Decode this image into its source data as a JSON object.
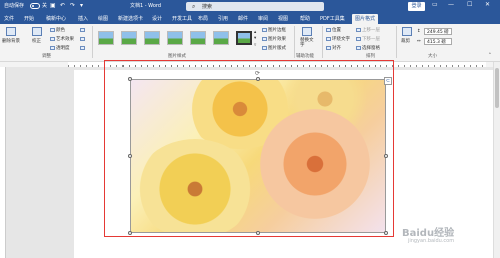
{
  "titlebar": {
    "autosave_label": "自动保存",
    "toggle_state": "关",
    "doc_title": "文档1 - Word",
    "search_placeholder": "搜索",
    "login_label": "登录",
    "color": "#2b579a"
  },
  "tabs": [
    "文件",
    "开始",
    "稿新中心",
    "插入",
    "绘图",
    "新建选项卡",
    "设计",
    "开发工具",
    "布局",
    "引用",
    "邮件",
    "审阅",
    "视图",
    "帮助",
    "PDF工具集",
    "图片格式"
  ],
  "active_tab": "图片格式",
  "ribbon": {
    "adjust": {
      "remove_bg": "删除背景",
      "corrections": "校正",
      "color": "颜色",
      "artistic": "艺术效果",
      "transparency": "透明度",
      "group_label": "调整"
    },
    "styles_group_label": "图片样式",
    "picture_border": "图片边框",
    "picture_effects": "图片效果",
    "picture_layout": "图片版式",
    "alt_text": "替换文字",
    "accessibility_label": "辅助功能",
    "position": "位置",
    "wrap_text": "环绕文字",
    "bring_forward": "上移一层",
    "send_backward": "下移一层",
    "selection_pane": "选择窗格",
    "align": "对齐",
    "arrange_label": "排列",
    "crop": "裁剪",
    "height": "249.45 磅",
    "width": "415.3 磅",
    "size_label": "大小"
  },
  "watermark": {
    "brand": "Baidu经验",
    "sub": "jingyan.baidu.com"
  }
}
